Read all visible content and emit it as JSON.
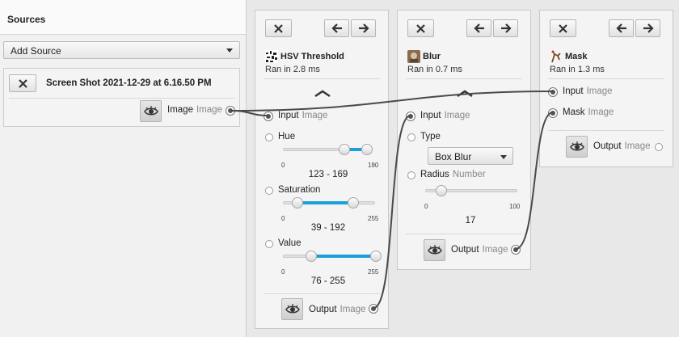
{
  "sources": {
    "header": "Sources",
    "add_source_label": "Add Source",
    "items": [
      {
        "title": "Screen Shot 2021-12-29 at 6.16.50 PM",
        "output_label": "Image",
        "output_type": "Image"
      }
    ]
  },
  "operations": {
    "hsv": {
      "title": "HSV Threshold",
      "ran": "Ran in 2.8 ms",
      "input_label": "Input",
      "input_type": "Image",
      "hue": {
        "label": "Hue",
        "min": "0",
        "max": "180",
        "value": "123 - 169",
        "low": 123,
        "high": 169,
        "range": 180
      },
      "saturation": {
        "label": "Saturation",
        "min": "0",
        "max": "255",
        "value": "39 - 192",
        "low": 39,
        "high": 192,
        "range": 255
      },
      "value": {
        "label": "Value",
        "min": "0",
        "max": "255",
        "value": "76 - 255",
        "low": 76,
        "high": 255,
        "range": 255
      },
      "output_label": "Output",
      "output_type": "Image"
    },
    "blur": {
      "title": "Blur",
      "ran": "Ran in 0.7 ms",
      "input_label": "Input",
      "input_type": "Image",
      "type_label": "Type",
      "type_value": "Box Blur",
      "radius_label": "Radius",
      "radius_type": "Number",
      "radius_min": "0",
      "radius_max": "100",
      "radius_value": "17",
      "radius": 17,
      "output_label": "Output",
      "output_type": "Image"
    },
    "mask": {
      "title": "Mask",
      "ran": "Ran in 1.3 ms",
      "input_label": "Input",
      "input_type": "Image",
      "mask_label": "Mask",
      "mask_type": "Image",
      "output_label": "Output",
      "output_type": "Image"
    }
  },
  "colors": {
    "accent": "#1aa0d8",
    "wire": "#4a4a4a"
  }
}
